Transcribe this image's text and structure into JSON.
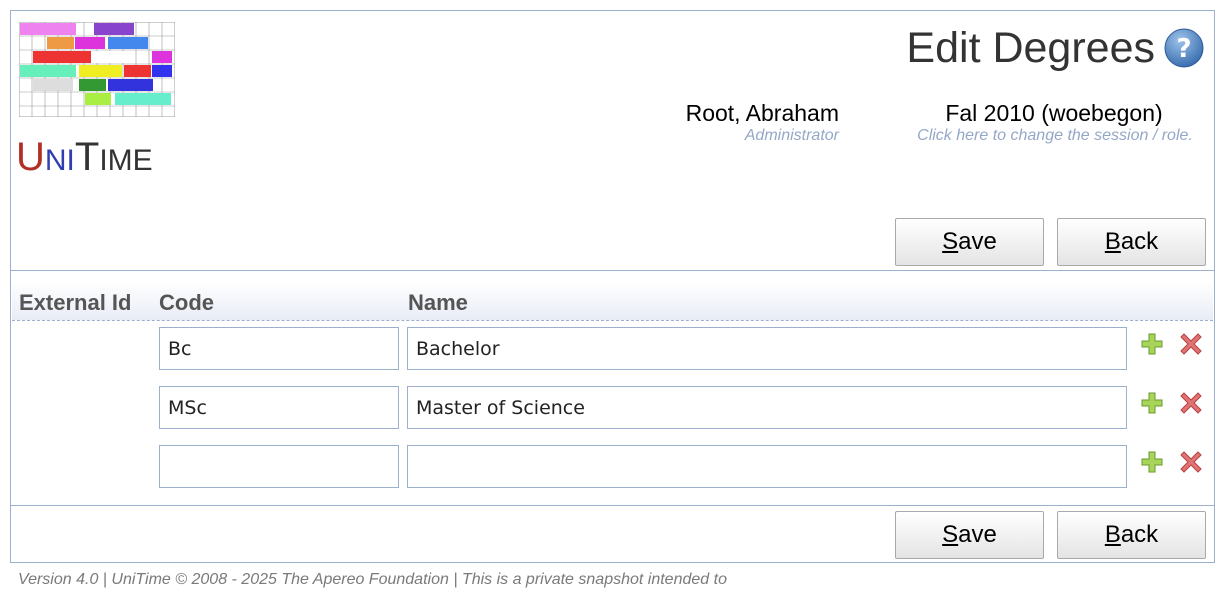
{
  "app": {
    "logo": "UniTime",
    "logo_letters": [
      "U",
      "NI",
      "T",
      "IME"
    ]
  },
  "header": {
    "title": "Edit Degrees",
    "help_icon": "help-icon",
    "user_name": "Root, Abraham",
    "user_role": "Administrator",
    "session_name": "Fal 2010 (woebegon)",
    "session_hint": "Click here to change the session / role."
  },
  "buttons": {
    "save_label": "Save",
    "save_underline": "S",
    "save_rest": "ave",
    "back_label": "Back",
    "back_underline": "B",
    "back_rest": "ack"
  },
  "table": {
    "columns": [
      "External Id",
      "Code",
      "Name"
    ],
    "rows": [
      {
        "external_id": "",
        "code": "Bc",
        "name": "Bachelor"
      },
      {
        "external_id": "",
        "code": "MSc",
        "name": "Master of Science"
      },
      {
        "external_id": "",
        "code": "",
        "name": ""
      }
    ],
    "row_icons": [
      "add-icon",
      "delete-icon"
    ]
  },
  "colors": {
    "border": "#9cb0ce",
    "hint": "#95a7c7",
    "add": "#8dc63f",
    "delete": "#d9534f"
  },
  "footer": {
    "text": "Version 4.0 | UniTime © 2008 - 2025 The Apereo Foundation | This is a private snapshot intended to"
  }
}
